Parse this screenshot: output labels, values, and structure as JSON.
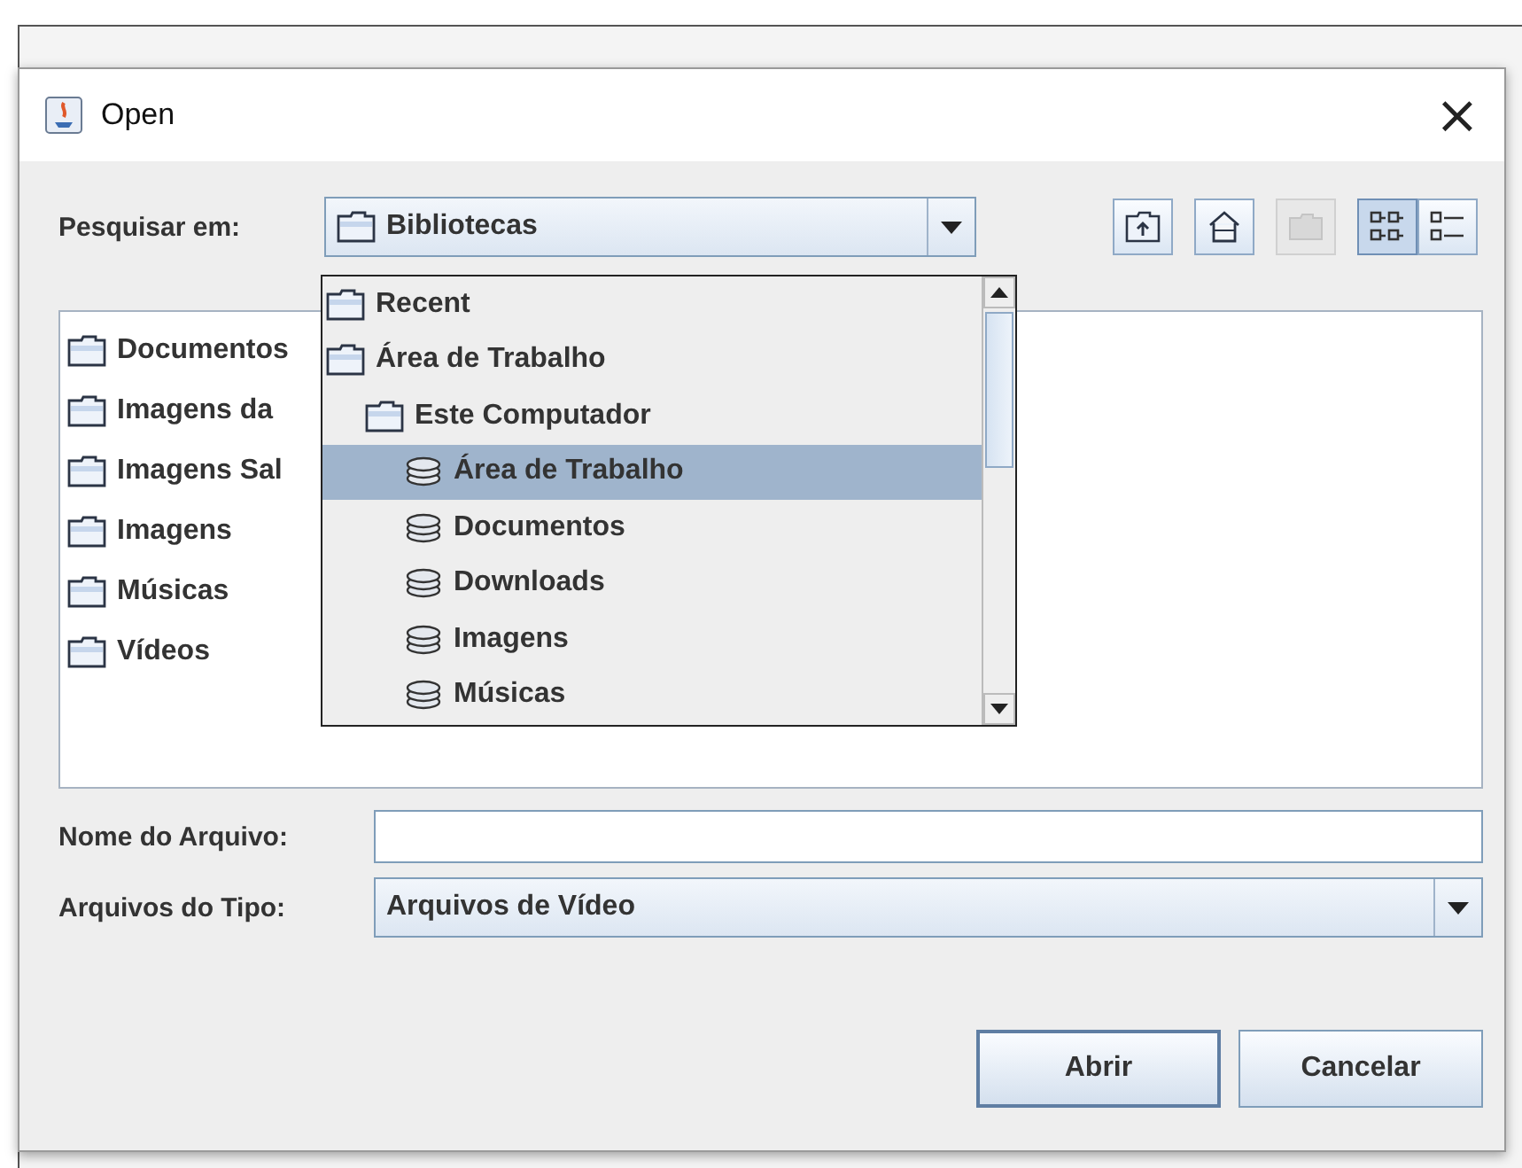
{
  "window": {
    "title": "Open",
    "close": "×"
  },
  "look_in": {
    "label": "Pesquisar em:",
    "value": "Bibliotecas"
  },
  "toolbar": [
    {
      "kind": "up-folder",
      "disabled": false,
      "selected": false
    },
    {
      "kind": "home",
      "disabled": false,
      "selected": false
    },
    {
      "kind": "new-folder",
      "disabled": true,
      "selected": false
    },
    {
      "kind": "list-view",
      "disabled": false,
      "selected": true
    },
    {
      "kind": "details-view",
      "disabled": false,
      "selected": false
    }
  ],
  "dropdown": {
    "items": [
      {
        "label": "Recent",
        "kind": "folder",
        "selected": false
      },
      {
        "label": "Área de Trabalho",
        "kind": "folder",
        "selected": false,
        "children": [
          {
            "label": "Este Computador",
            "kind": "folder",
            "selected": false,
            "children": [
              {
                "label": "Área de Trabalho",
                "kind": "drive",
                "selected": true
              },
              {
                "label": "Documentos",
                "kind": "drive",
                "selected": false
              },
              {
                "label": "Downloads",
                "kind": "drive",
                "selected": false
              },
              {
                "label": "Imagens",
                "kind": "drive",
                "selected": false
              },
              {
                "label": "Músicas",
                "kind": "drive",
                "selected": false
              }
            ]
          }
        ]
      }
    ]
  },
  "files": [
    {
      "name": "Documentos"
    },
    {
      "name": "Imagens da"
    },
    {
      "name": "Imagens Sal"
    },
    {
      "name": "Imagens"
    },
    {
      "name": "Músicas"
    },
    {
      "name": "Vídeos"
    }
  ],
  "file_name": {
    "label": "Nome do Arquivo:"
  },
  "file_type": {
    "label": "Arquivos do Tipo:",
    "value": "Arquivos de Vídeo"
  },
  "buttons": [
    {
      "label": "Abrir",
      "kind": "primary"
    },
    {
      "label": "Cancelar",
      "kind": "secondary"
    }
  ]
}
